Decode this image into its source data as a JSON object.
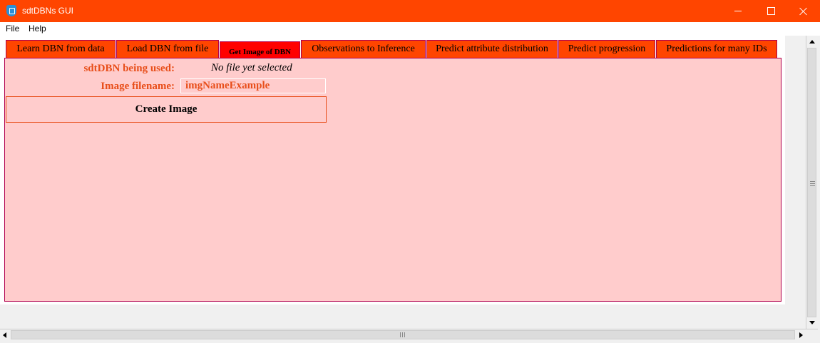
{
  "window": {
    "title": "sdtDBNs GUI",
    "icon": "app-icon",
    "title_bar_color": "#ff4500"
  },
  "menu": {
    "items": [
      "File",
      "Help"
    ]
  },
  "tabs": [
    {
      "label": "Learn DBN from data",
      "active": false
    },
    {
      "label": "Load DBN from file",
      "active": false
    },
    {
      "label": "Get Image of DBN",
      "active": true
    },
    {
      "label": "Observations to Inference",
      "active": false
    },
    {
      "label": "Predict attribute distribution",
      "active": false
    },
    {
      "label": "Predict progression",
      "active": false
    },
    {
      "label": "Predictions for many IDs",
      "active": false
    }
  ],
  "panel": {
    "dbn_label": "sdtDBN being used:",
    "dbn_value": "No file yet selected",
    "image_label": "Image filename:",
    "image_value": "imgNameExample",
    "create_button": "Create Image",
    "background_color": "#ffcccc",
    "label_color": "#e84e1a"
  }
}
